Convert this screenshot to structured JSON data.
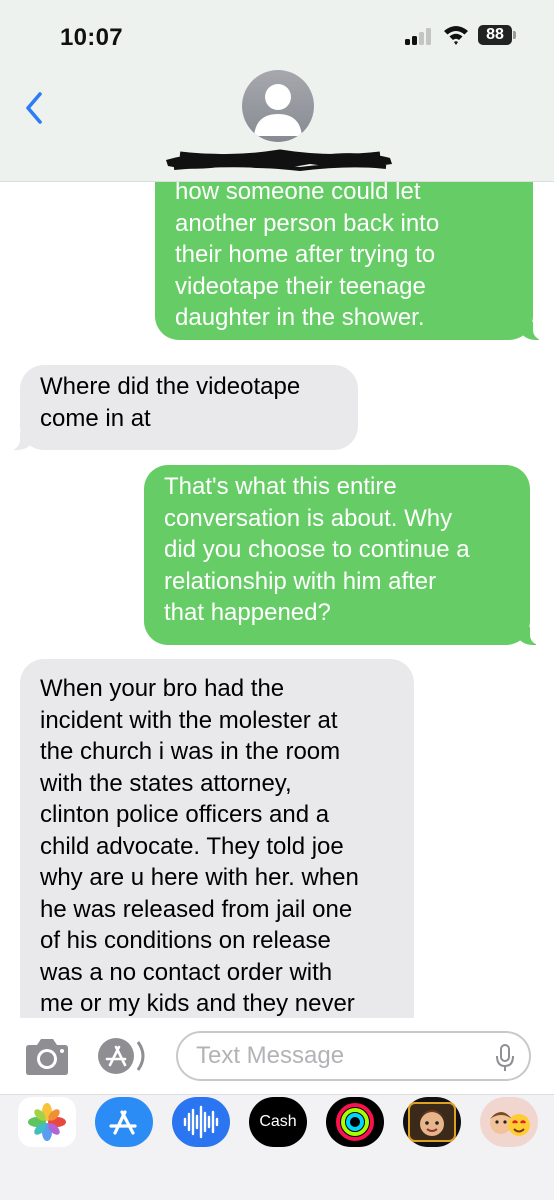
{
  "status_bar": {
    "time": "10:07",
    "battery": "88"
  },
  "header": {
    "back_icon": "chevron-left-icon",
    "avatar_icon": "person-placeholder-icon",
    "contact_name_redacted": true
  },
  "messages": [
    {
      "direction": "outgoing",
      "lines": [
        "how someone could let",
        "another person back into",
        "their home after trying to",
        "videotape their teenage",
        "daughter in the shower."
      ]
    },
    {
      "direction": "incoming",
      "lines": [
        "Where did the videotape",
        "come in at"
      ]
    },
    {
      "direction": "outgoing",
      "lines": [
        "That's what this entire",
        "conversation is about. Why",
        "did you choose to continue a",
        "relationship with him after",
        "that happened?"
      ]
    },
    {
      "direction": "incoming",
      "lines": [
        "When your bro had the",
        "incident with the molester at",
        "the church i was in the room",
        "with the states attorney,",
        "clinton police officers and a",
        "child advocate. They told joe",
        "why are u here with her. when",
        "he was released from jail one",
        "of his conditions on release",
        "was a no contact order with",
        "me or my kids and they never"
      ]
    }
  ],
  "input_bar": {
    "placeholder": "Text Message",
    "value": ""
  },
  "app_drawer": {
    "apps": [
      "photos-icon",
      "app-store-icon",
      "audio-message-icon",
      "cash-icon",
      "fitness-icon",
      "memoji-icon",
      "memoji-stickers-icon"
    ],
    "cash_label": "Cash"
  },
  "colors": {
    "outgoing_bubble": "#66cd66",
    "incoming_bubble": "#e9e9eb",
    "accent": "#2c7cf6"
  }
}
